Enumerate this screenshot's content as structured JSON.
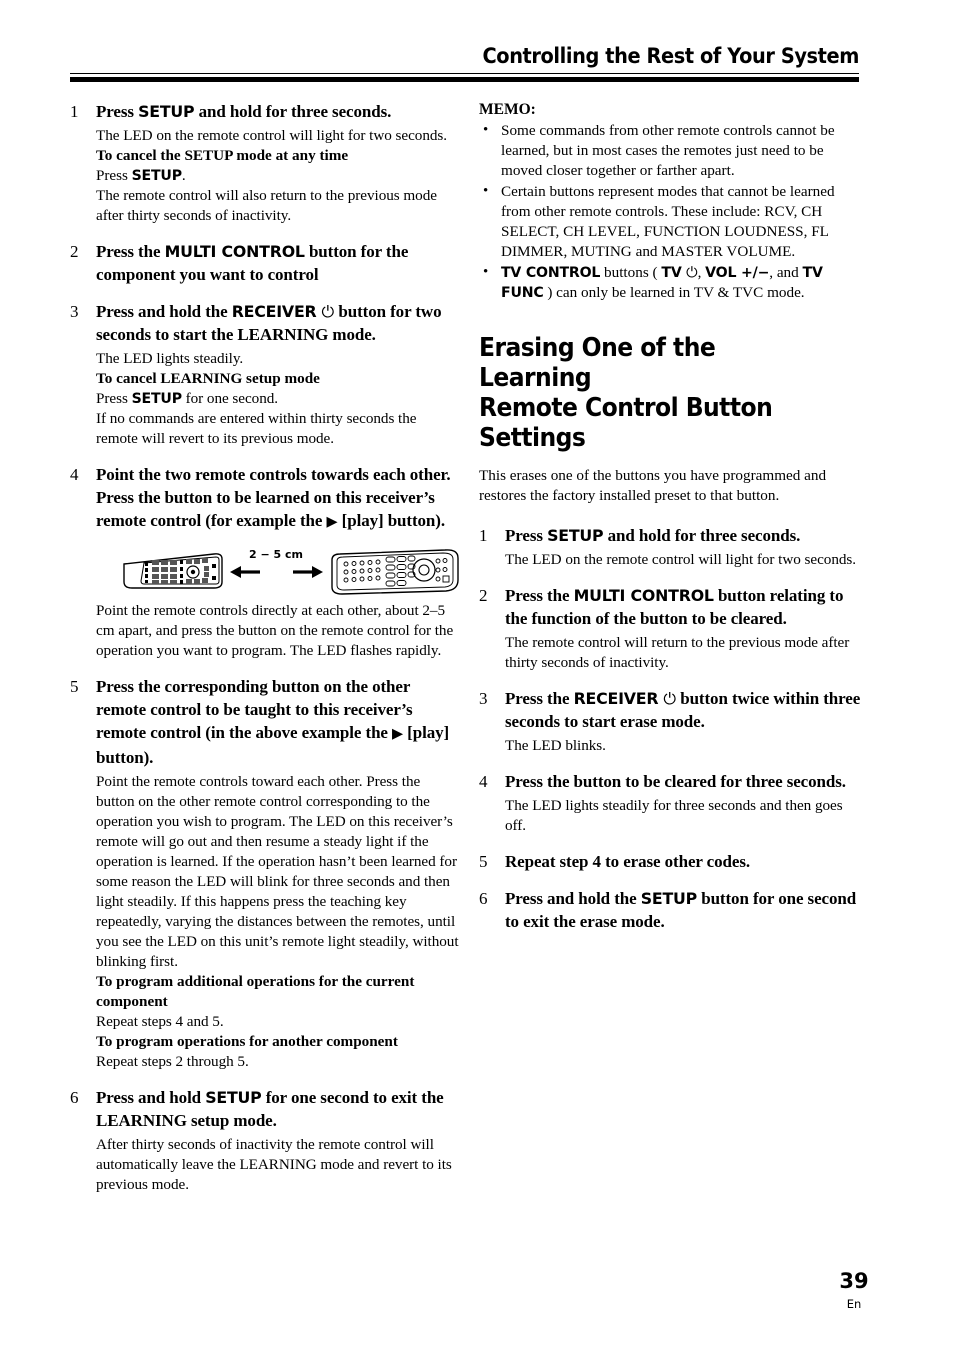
{
  "header": {
    "title": "Controlling the Rest of Your System"
  },
  "left_column": {
    "steps": [
      {
        "num": "1",
        "head_pre": "Press ",
        "head_btn": "SETUP",
        "head_post": " and hold for three seconds.",
        "body_lines": [
          {
            "type": "normal",
            "text": "The LED on the remote control will light for two seconds."
          },
          {
            "type": "bold",
            "text": "To cancel the SETUP mode at any time"
          },
          {
            "type": "mixed",
            "pre": "Press ",
            "btn": "SETUP",
            "post": "."
          },
          {
            "type": "normal",
            "text": "The remote control will also return to the previous mode after thirty seconds of inactivity."
          }
        ]
      },
      {
        "num": "2",
        "head_pre": "Press the ",
        "head_btn": "MULTI CONTROL",
        "head_post": " button for the component you want to control"
      },
      {
        "num": "3",
        "head_pre": "Press and hold the ",
        "head_btn": "RECEIVER",
        "head_symbol": "⏻",
        "head_post": " button for two seconds to start the LEARNING mode.",
        "body_lines": [
          {
            "type": "normal",
            "text": "The LED lights steadily."
          },
          {
            "type": "bold",
            "text": "To cancel LEARNING setup mode"
          },
          {
            "type": "mixed",
            "pre": "Press ",
            "btn": "SETUP",
            "post": " for one second."
          },
          {
            "type": "normal",
            "text": "If no commands are entered within thirty seconds the remote will revert to its previous mode."
          }
        ]
      },
      {
        "num": "4",
        "head_plain_a": "Point the two remote controls towards each other. Press the button to be learned on this receiver’s remote control (for example the ",
        "head_triangle": "▶",
        "head_plain_b": " [play] button).",
        "body_lines": [
          {
            "type": "normal",
            "text": "Point the remote controls directly at each other, about 2–5 cm apart, and press the button on the remote control for the operation you want to program. The LED flashes rapidly."
          }
        ]
      },
      {
        "num": "5",
        "head_plain_a": "Press the corresponding button on the other remote control to be taught to this receiver’s remote control (in the above example the ",
        "head_triangle": "▶",
        "head_plain_b": " [play] button).",
        "body_lines": [
          {
            "type": "normal",
            "text": "Point the remote controls toward each other. Press the button on the other remote control corresponding to the operation you wish to program. The LED on this receiver’s remote will go out and then resume a steady light if the operation is learned. If the operation hasn’t been learned for some reason the LED will blink for three seconds and then light steadily. If this happens press the teaching key repeatedly, varying the distances between the remotes, until you see the LED on this unit’s remote light steadily, without blinking first."
          },
          {
            "type": "bold",
            "text": "To program additional operations for the current component"
          },
          {
            "type": "normal",
            "text": "Repeat steps 4 and 5."
          },
          {
            "type": "bold",
            "text": "To program operations for another component"
          },
          {
            "type": "normal",
            "text": "Repeat steps 2 through 5."
          }
        ]
      },
      {
        "num": "6",
        "head_pre": "Press and hold ",
        "head_btn": "SETUP",
        "head_post": " for one second to exit the LEARNING setup mode.",
        "body_lines": [
          {
            "type": "normal",
            "text": "After thirty seconds of inactivity the remote control will automatically leave the LEARNING mode and revert to its previous mode."
          }
        ]
      }
    ],
    "figure": {
      "distance_label": "2 − 5 cm",
      "left_remote_name": "learning-remote",
      "right_remote_name": "receiver-remote"
    }
  },
  "right_column": {
    "memo": {
      "title": "MEMO:",
      "bullet_glyph": "•",
      "items": [
        {
          "type": "plain",
          "text": "Some commands from other remote controls cannot be learned, but in most cases the remotes just need to be moved closer together or farther apart."
        },
        {
          "type": "plain",
          "text": "Certain buttons represent modes that cannot be learned from other remote controls. These include: RCV, CH SELECT, CH  LEVEL, FUNCTION LOUDNESS, FL DIMMER, MUTING and MASTER VOLUME."
        },
        {
          "type": "rich",
          "btn1": "TV CONTROL",
          "mid1": " buttons ( ",
          "btn2": "TV",
          "symbol": "⏻",
          "mid2": ", ",
          "btn3": "VOL +/−",
          "mid3": ", and ",
          "btn4": "TV FUNC",
          "tail": " ) can only be learned in TV & TVC mode."
        }
      ]
    },
    "section": {
      "heading_line1": "Erasing One of the Learning",
      "heading_line2": "Remote Control Button Settings",
      "intro": "This erases one of the buttons you have programmed and restores the factory installed preset to that button."
    },
    "steps": [
      {
        "num": "1",
        "head_pre": "Press ",
        "head_btn": "SETUP",
        "head_post": " and hold for three seconds.",
        "body_lines": [
          {
            "type": "normal",
            "text": "The LED on the remote control will light for two seconds."
          }
        ]
      },
      {
        "num": "2",
        "head_pre": "Press the ",
        "head_btn": "MULTI CONTROL",
        "head_post": " button relating to the function of the button to be cleared.",
        "body_lines": [
          {
            "type": "normal",
            "text": "The remote control will return to the previous mode after thirty seconds of inactivity."
          }
        ]
      },
      {
        "num": "3",
        "head_pre": "Press the ",
        "head_btn": "RECEIVER",
        "head_symbol": "⏻",
        "head_post": " button twice within three seconds to start erase mode.",
        "body_lines": [
          {
            "type": "normal",
            "text": "The LED blinks."
          }
        ]
      },
      {
        "num": "4",
        "head_plain_a": "Press the button to be cleared for three seconds.",
        "body_lines": [
          {
            "type": "normal",
            "text": "The LED lights steadily for three seconds and then goes off."
          }
        ]
      },
      {
        "num": "5",
        "head_plain_a": "Repeat step 4 to erase other codes."
      },
      {
        "num": "6",
        "head_pre": "Press and hold the ",
        "head_btn": "SETUP",
        "head_post": " button for one second to exit the erase mode."
      }
    ]
  },
  "footer": {
    "page_number": "39",
    "language": "En"
  }
}
